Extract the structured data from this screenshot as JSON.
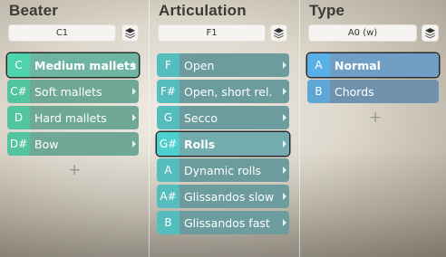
{
  "columns": [
    {
      "title": "Beater",
      "key_value": "C1",
      "add_label": "+",
      "items": [
        {
          "key": "C",
          "label": "Medium mallets",
          "selected": true
        },
        {
          "key": "C#",
          "label": "Soft mallets",
          "selected": false
        },
        {
          "key": "D",
          "label": "Hard mallets",
          "selected": false
        },
        {
          "key": "D#",
          "label": "Bow",
          "selected": false
        }
      ]
    },
    {
      "title": "Articulation",
      "key_value": "F1",
      "add_label": "+",
      "items": [
        {
          "key": "F",
          "label": "Open",
          "selected": false
        },
        {
          "key": "F#",
          "label": "Open, short rel.",
          "selected": false
        },
        {
          "key": "G",
          "label": "Secco",
          "selected": false
        },
        {
          "key": "G#",
          "label": "Rolls",
          "selected": true
        },
        {
          "key": "A",
          "label": "Dynamic rolls",
          "selected": false
        },
        {
          "key": "A#",
          "label": "Glissandos slow",
          "selected": false
        },
        {
          "key": "B",
          "label": "Glissandos fast",
          "selected": false
        }
      ]
    },
    {
      "title": "Type",
      "key_value": "A0 (w)",
      "add_label": "+",
      "items": [
        {
          "key": "A",
          "label": "Normal",
          "selected": true
        },
        {
          "key": "B",
          "label": "Chords",
          "selected": false
        }
      ]
    }
  ],
  "icons": {
    "layers": "layers-icon",
    "submenu": "chevron-right-icon"
  }
}
